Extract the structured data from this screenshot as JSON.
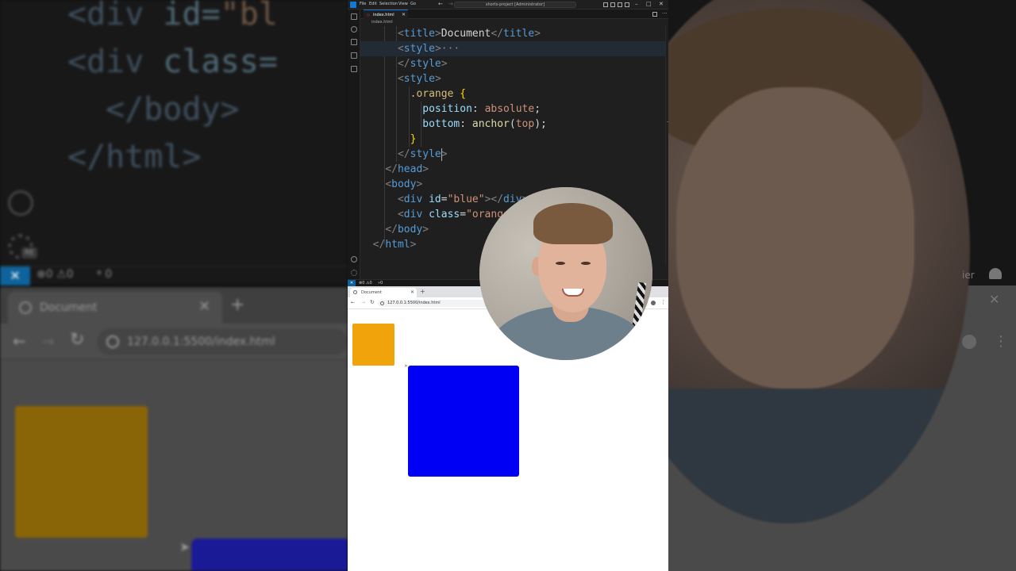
{
  "background": {
    "code_lines": [
      {
        "indent": "    ",
        "open": "<",
        "name": "div",
        "attr": " id=",
        "str": "\"bl",
        "tail": ""
      },
      {
        "indent": "    ",
        "open": "<",
        "name": "div",
        "attr": " class=",
        "str": "",
        "tail": ""
      },
      {
        "indent": "  ",
        "open": "</",
        "name": "body",
        "attr": "",
        "str": "",
        "tail": ">"
      },
      {
        "indent": "",
        "open": "</",
        "name": "html",
        "attr": "",
        "str": "",
        "tail": ">"
      }
    ],
    "gear_badge": "RE",
    "status_problems": "⊗0 ⚠0",
    "status_ports": "ᵠ 0",
    "right_status_text": "ier",
    "tab_title": "Document",
    "url": "127.0.0.1:5500/index.html"
  },
  "vscode": {
    "menu": [
      "File",
      "Edit",
      "Selection",
      "View",
      "Go"
    ],
    "search_text": "shorts-project [Administrator]",
    "tab_label": "index.html",
    "breadcrumb": "index.html",
    "status_problems": "⊗0 ⚠0",
    "status_ports": "⑂0"
  },
  "browser": {
    "tab_title": "Document",
    "url": "127.0.0.1:5500/index.html"
  },
  "colors": {
    "orange_box": "#f0a30a",
    "blue_box": "#0000f5",
    "vscode_accent": "#0e639c"
  }
}
